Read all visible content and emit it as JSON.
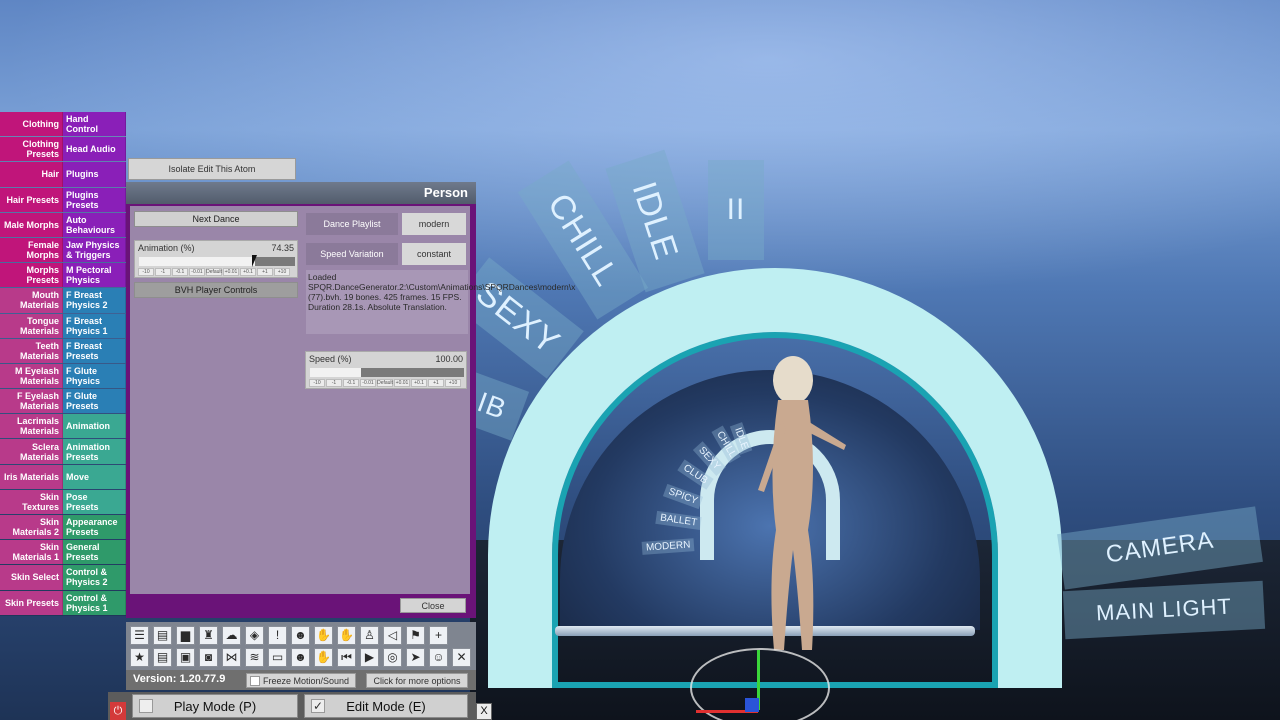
{
  "scene": {
    "signs": {
      "chill": "CHILL",
      "idle": "IDLE",
      "pause": "II",
      "sexy": "SEXY",
      "club": "IB",
      "camera": "CAMERA",
      "main_light": "MAIN LIGHT"
    },
    "small_signs": [
      "MODERN",
      "BALLET",
      "SPICY",
      "CLUB",
      "SEXY",
      "CHILL",
      "IDLE"
    ]
  },
  "menu": {
    "rows": [
      {
        "left": "Clothing",
        "right": "Hand Control"
      },
      {
        "left": "Clothing Presets",
        "right": "Head Audio"
      },
      {
        "left": "Hair",
        "right": "Plugins"
      },
      {
        "left": "Hair Presets",
        "right": "Plugins Presets"
      },
      {
        "left": "Male Morphs",
        "right": "Auto Behaviours"
      },
      {
        "left": "Female Morphs",
        "right": "Jaw Physics & Triggers"
      },
      {
        "left": "Morphs Presets",
        "right": "M Pectoral Physics"
      },
      {
        "left": "Mouth Materials",
        "right": "F Breast Physics 2"
      },
      {
        "left": "Tongue Materials",
        "right": "F Breast Physics 1"
      },
      {
        "left": "Teeth Materials",
        "right": "F Breast Presets"
      },
      {
        "left": "M Eyelash Materials",
        "right": "F Glute Physics"
      },
      {
        "left": "F Eyelash Materials",
        "right": "F Glute Presets"
      },
      {
        "left": "Lacrimals Materials",
        "right": "Animation"
      },
      {
        "left": "Sclera Materials",
        "right": "Animation Presets"
      },
      {
        "left": "Iris Materials",
        "right": "Move"
      },
      {
        "left": "Skin Textures",
        "right": "Pose Presets"
      },
      {
        "left": "Skin Materials 2",
        "right": "Appearance Presets"
      },
      {
        "left": "Skin Materials 1",
        "right": "General Presets"
      },
      {
        "left": "Skin Select",
        "right": "Control & Physics 2"
      },
      {
        "left": "Skin Presets",
        "right": "Control & Physics 1"
      }
    ]
  },
  "isolate_button": "Isolate Edit This Atom",
  "panel": {
    "title": "Person",
    "next_dance": "Next Dance",
    "animation_slider": {
      "label": "Animation (%)",
      "value": "74.35",
      "fraction": 0.7435,
      "ticks": [
        "-10",
        "-1",
        "-0.1",
        "-0.01",
        "Default",
        "+0.01",
        "+0.1",
        "+1",
        "+10"
      ]
    },
    "bvh_controls": "BVH Player Controls",
    "dance_playlist_label": "Dance Playlist",
    "dance_playlist_value": "modern",
    "speed_variation_label": "Speed Variation",
    "speed_variation_value": "constant",
    "info": "Loaded SPQR.DanceGenerator.2:\\Custom\\Animations\\SPQRDances\\modern\\x (77).bvh. 19 bones. 425 frames. 15 FPS. Duration 28.1s. Absolute Translation.",
    "speed_slider": {
      "label": "Speed (%)",
      "value": "100.00",
      "fraction": 0.333,
      "ticks": [
        "-10",
        "-1",
        "-0.1",
        "-0.01",
        "Default",
        "+0.01",
        "+0.1",
        "+1",
        "+10"
      ]
    },
    "close": "Close"
  },
  "toolbar": {
    "row1": [
      "menu-icon",
      "scene-open-icon",
      "folder-icon",
      "seat-icon",
      "cloud-icon",
      "cube-icon",
      "alert-icon",
      "person-icon",
      "hand-icon",
      "hand-icon",
      "user-icon",
      "unity-icon",
      "flag-icon",
      "plus-icon"
    ],
    "row2": [
      "star-icon",
      "scene-icon",
      "media-icon",
      "camera-icon",
      "nodes-icon",
      "layers-icon",
      "document-icon",
      "person-edit-icon",
      "hand-edit-icon",
      "step-back-icon",
      "play-icon",
      "target-icon",
      "pointer-icon",
      "users-icon",
      "tools-icon"
    ]
  },
  "version": "Version: 1.20.77.9",
  "freeze_label": "Freeze Motion/Sound",
  "more_options": "Click for more options",
  "play_mode": "Play Mode (P)",
  "edit_mode": "Edit Mode (E)",
  "edit_check": "✓",
  "close_x": "X"
}
